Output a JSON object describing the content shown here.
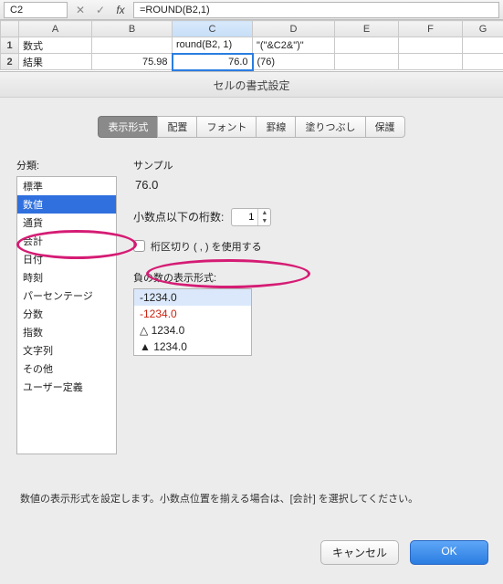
{
  "formula_bar": {
    "cell_ref": "C2",
    "formula": "=ROUND(B2,1)",
    "icons": {
      "cancel": "✕",
      "confirm": "✓",
      "fx": "fx"
    }
  },
  "columns": [
    "A",
    "B",
    "C",
    "D",
    "E",
    "F",
    "G"
  ],
  "rows": [
    {
      "hdr": "1",
      "cells": [
        "数式",
        "",
        "round(B2, 1)",
        "\"(\"&C2&\")\"",
        "",
        "",
        ""
      ]
    },
    {
      "hdr": "2",
      "cells": [
        "結果",
        "75.98",
        "76.0",
        "(76)",
        "",
        "",
        ""
      ]
    }
  ],
  "dialog": {
    "title": "セルの書式設定",
    "tabs": [
      "表示形式",
      "配置",
      "フォント",
      "罫線",
      "塗りつぶし",
      "保護"
    ],
    "active_tab": 0,
    "category_label": "分類:",
    "categories": [
      "標準",
      "数値",
      "通貨",
      "会計",
      "日付",
      "時刻",
      "パーセンテージ",
      "分数",
      "指数",
      "文字列",
      "その他",
      "ユーザー定義"
    ],
    "selected_category": 1,
    "sample_label": "サンプル",
    "sample_value": "76.0",
    "decimal_label": "小数点以下の桁数:",
    "decimal_value": "1",
    "thousands_label": "桁区切り ( , ) を使用する",
    "negative_label": "負の数の表示形式:",
    "negative_formats": [
      "-1234.0",
      "-1234.0",
      "△ 1234.0",
      "▲ 1234.0"
    ],
    "negative_selected": 0,
    "hint": "数値の表示形式を設定します。小数点位置を揃える場合は、[会計] を選択してください。",
    "cancel": "キャンセル",
    "ok": "OK"
  }
}
